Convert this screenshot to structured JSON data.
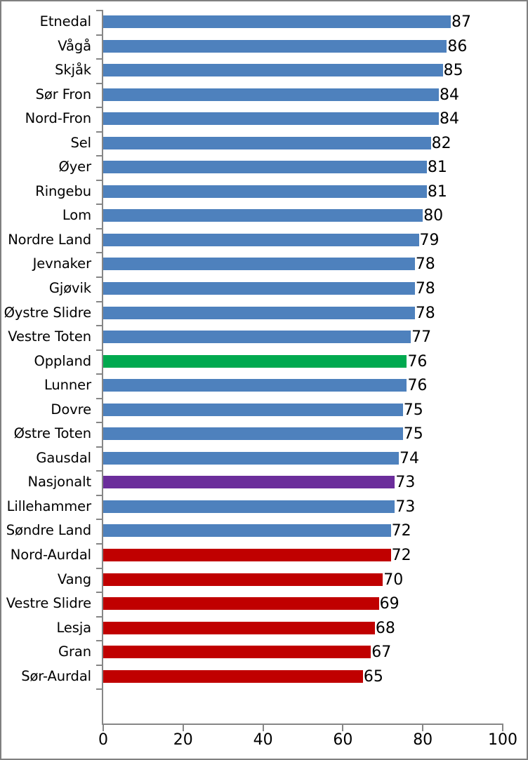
{
  "chart_data": {
    "type": "bar",
    "orientation": "horizontal",
    "title": "",
    "subtitle": "",
    "xlabel": "",
    "ylabel": "",
    "xlim": [
      0,
      100
    ],
    "xticks": [
      0,
      20,
      40,
      60,
      80,
      100
    ],
    "xtick_labels": [
      "0",
      "20",
      "40",
      "60",
      "80",
      "100"
    ],
    "grid": false,
    "legend": null,
    "value_labels_shown": true,
    "sorted": "descending",
    "colors": {
      "default": "#4E81BD",
      "highlight_region": "#00A94F",
      "highlight_national": "#6B2D9B",
      "below_national": "#C00000",
      "axis": "#868686",
      "text": "#000000",
      "background": "#FFFFFF",
      "frame_border": "#808080"
    },
    "categories": [
      "Etnedal",
      "Vågå",
      "Skjåk",
      "Sør Fron",
      "Nord-Fron",
      "Sel",
      "Øyer",
      "Ringebu",
      "Lom",
      "Nordre Land",
      "Jevnaker",
      "Gjøvik",
      "Øystre Slidre",
      "Vestre Toten",
      "Oppland",
      "Lunner",
      "Dovre",
      "Østre Toten",
      "Gausdal",
      "Nasjonalt",
      "Lillehammer",
      "Søndre Land",
      "Nord-Aurdal",
      "Vang",
      "Vestre Slidre",
      "Lesja",
      "Gran",
      "Sør-Aurdal"
    ],
    "values": [
      87,
      86,
      85,
      84,
      84,
      82,
      81,
      81,
      80,
      79,
      78,
      78,
      78,
      77,
      76,
      76,
      75,
      75,
      74,
      73,
      73,
      72,
      72,
      70,
      69,
      68,
      67,
      65
    ],
    "bars": [
      {
        "label": "Etnedal",
        "value": 87,
        "color": "#4E81BD"
      },
      {
        "label": "Vågå",
        "value": 86,
        "color": "#4E81BD"
      },
      {
        "label": "Skjåk",
        "value": 85,
        "color": "#4E81BD"
      },
      {
        "label": "Sør Fron",
        "value": 84,
        "color": "#4E81BD"
      },
      {
        "label": "Nord-Fron",
        "value": 84,
        "color": "#4E81BD"
      },
      {
        "label": "Sel",
        "value": 82,
        "color": "#4E81BD"
      },
      {
        "label": "Øyer",
        "value": 81,
        "color": "#4E81BD"
      },
      {
        "label": "Ringebu",
        "value": 81,
        "color": "#4E81BD"
      },
      {
        "label": "Lom",
        "value": 80,
        "color": "#4E81BD"
      },
      {
        "label": "Nordre Land",
        "value": 79,
        "color": "#4E81BD"
      },
      {
        "label": "Jevnaker",
        "value": 78,
        "color": "#4E81BD"
      },
      {
        "label": "Gjøvik",
        "value": 78,
        "color": "#4E81BD"
      },
      {
        "label": "Øystre Slidre",
        "value": 78,
        "color": "#4E81BD"
      },
      {
        "label": "Vestre Toten",
        "value": 77,
        "color": "#4E81BD"
      },
      {
        "label": "Oppland",
        "value": 76,
        "color": "#00A94F"
      },
      {
        "label": "Lunner",
        "value": 76,
        "color": "#4E81BD"
      },
      {
        "label": "Dovre",
        "value": 75,
        "color": "#4E81BD"
      },
      {
        "label": "Østre Toten",
        "value": 75,
        "color": "#4E81BD"
      },
      {
        "label": "Gausdal",
        "value": 74,
        "color": "#4E81BD"
      },
      {
        "label": "Nasjonalt",
        "value": 73,
        "color": "#6B2D9B"
      },
      {
        "label": "Lillehammer",
        "value": 73,
        "color": "#4E81BD"
      },
      {
        "label": "Søndre Land",
        "value": 72,
        "color": "#4E81BD"
      },
      {
        "label": "Nord-Aurdal",
        "value": 72,
        "color": "#C00000"
      },
      {
        "label": "Vang",
        "value": 70,
        "color": "#C00000"
      },
      {
        "label": "Vestre Slidre",
        "value": 69,
        "color": "#C00000"
      },
      {
        "label": "Lesja",
        "value": 68,
        "color": "#C00000"
      },
      {
        "label": "Gran",
        "value": 67,
        "color": "#C00000"
      },
      {
        "label": "Sør-Aurdal",
        "value": 65,
        "color": "#C00000"
      }
    ]
  }
}
